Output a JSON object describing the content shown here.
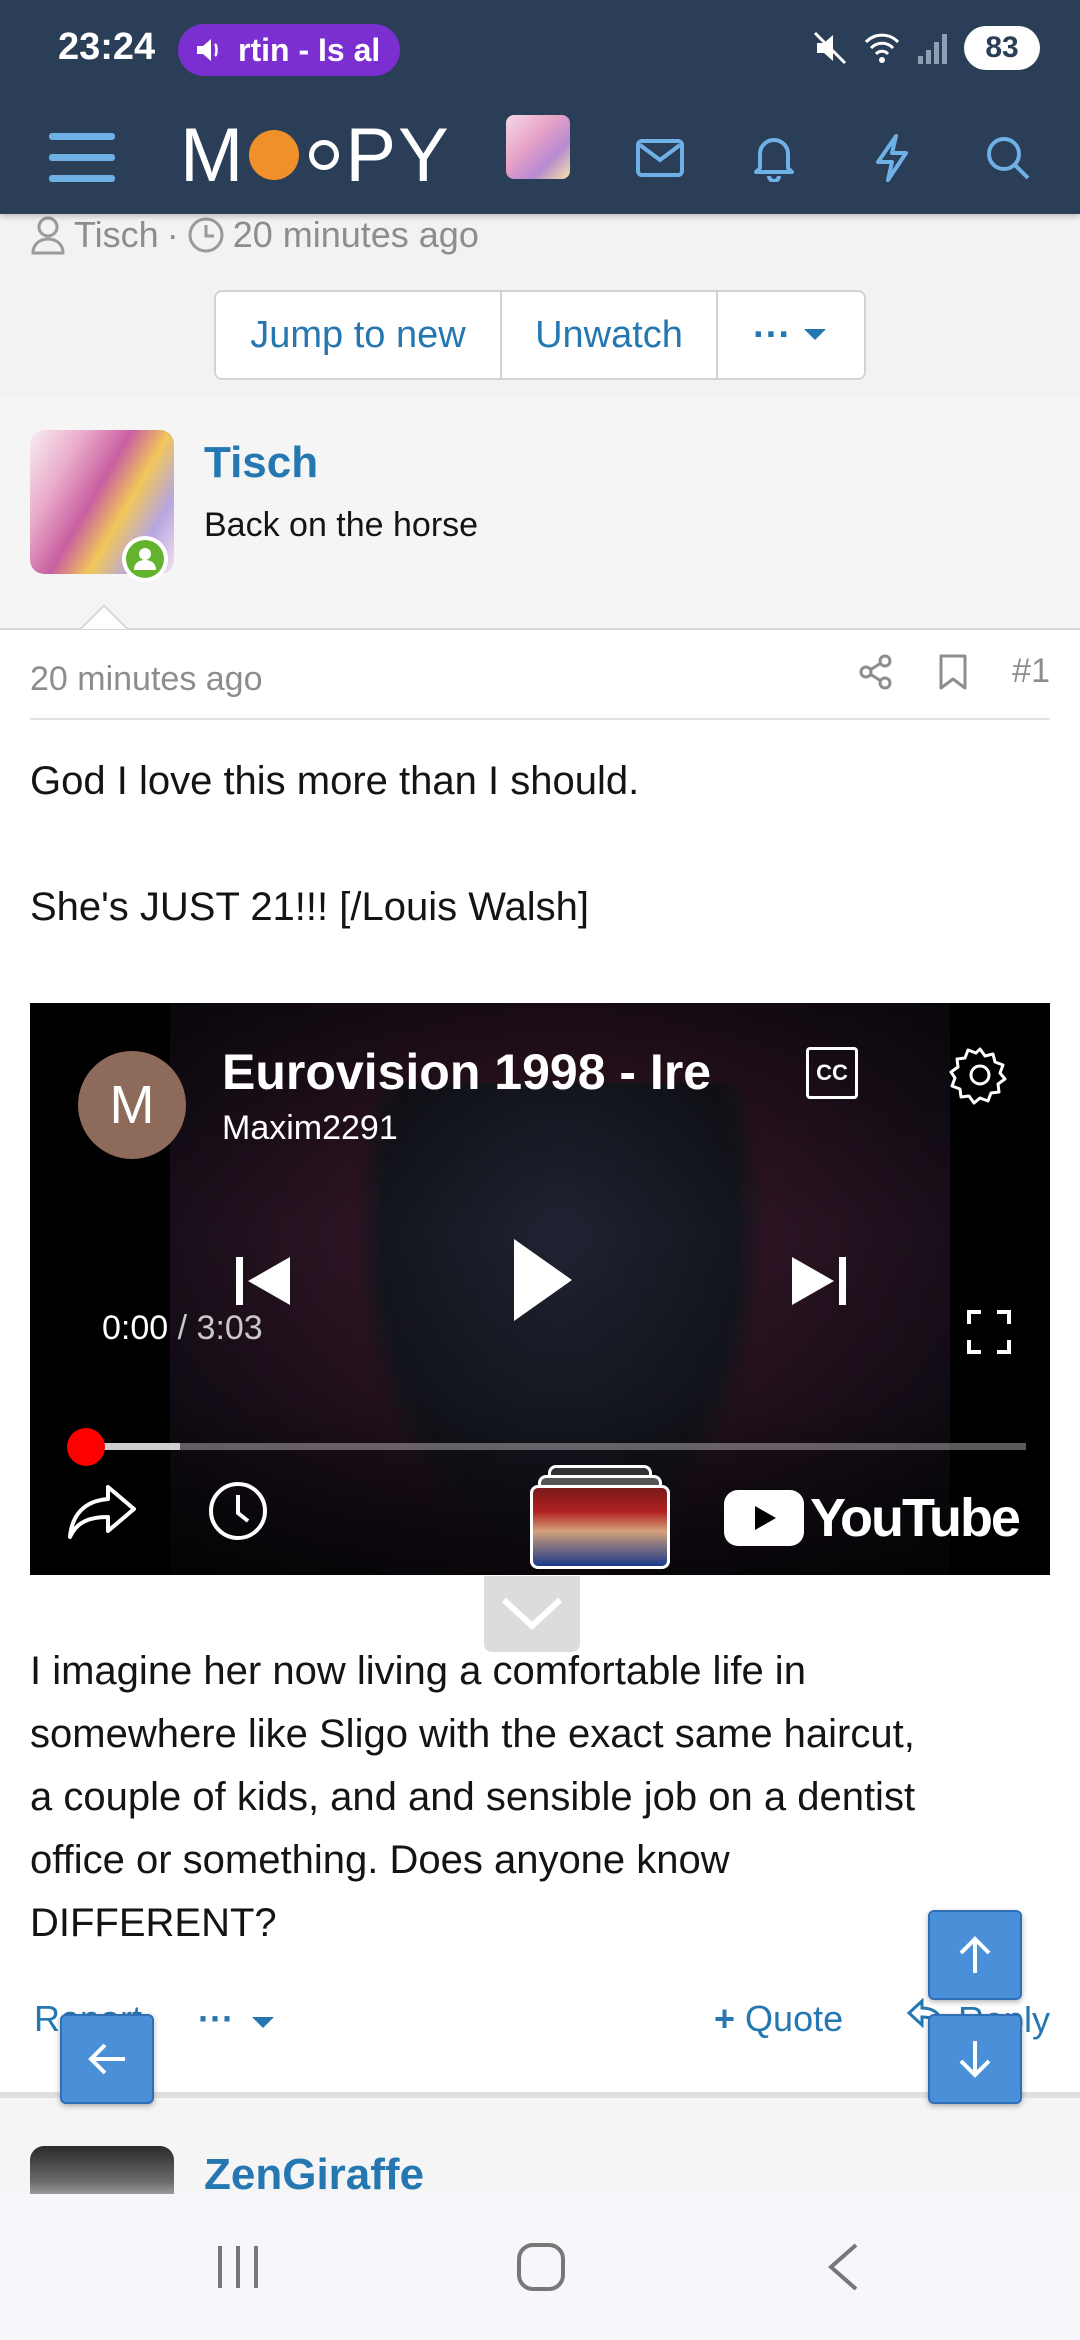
{
  "status_bar": {
    "time": "23:24",
    "media_text": "rtin - Is al",
    "battery": "83"
  },
  "header": {
    "logo_text_left": "M",
    "logo_text_right": "PY",
    "icons": [
      "menu-icon",
      "forum-avatar",
      "mail-icon",
      "bell-icon",
      "lightning-icon",
      "search-icon"
    ]
  },
  "thread": {
    "starter": "Tisch",
    "separator": "·",
    "started_ago": "20 minutes ago",
    "buttons": {
      "jump": "Jump to new",
      "unwatch": "Unwatch",
      "more": "···"
    }
  },
  "post": {
    "author": "Tisch",
    "author_title": "Back on the horse",
    "time": "20 minutes ago",
    "number": "#1",
    "line1": "God I love this more than I should.",
    "line2": "She's JUST 21!!! [/Louis Walsh]",
    "after_lines": [
      "I imagine her now living a comfortable life in",
      "somewhere like Sligo with the exact same haircut,",
      "a couple of kids, and and sensible job on a dentist",
      "office or something. Does anyone know",
      "DIFFERENT?"
    ],
    "actions": {
      "report": "Report",
      "more": "···",
      "quote": "Quote",
      "quote_prefix": "+",
      "reply": "Reply"
    }
  },
  "video": {
    "channel_initial": "M",
    "title": "Eurovision 1998 - Ire",
    "channel": "Maxim2291",
    "cc": "CC",
    "current_time": "0:00",
    "time_separator": "/",
    "duration": "3:03",
    "progress_fraction": 0.0,
    "buffered_fraction": 0.1,
    "platform": "YouTube"
  },
  "next_post": {
    "author": "ZenGiraffe"
  },
  "colors": {
    "header_bg": "#2b3e57",
    "link": "#2577b1",
    "accent_orange": "#f0902a",
    "fab": "#4a90d9",
    "youtube_red": "#ff0000",
    "online_green": "#63b32e"
  }
}
